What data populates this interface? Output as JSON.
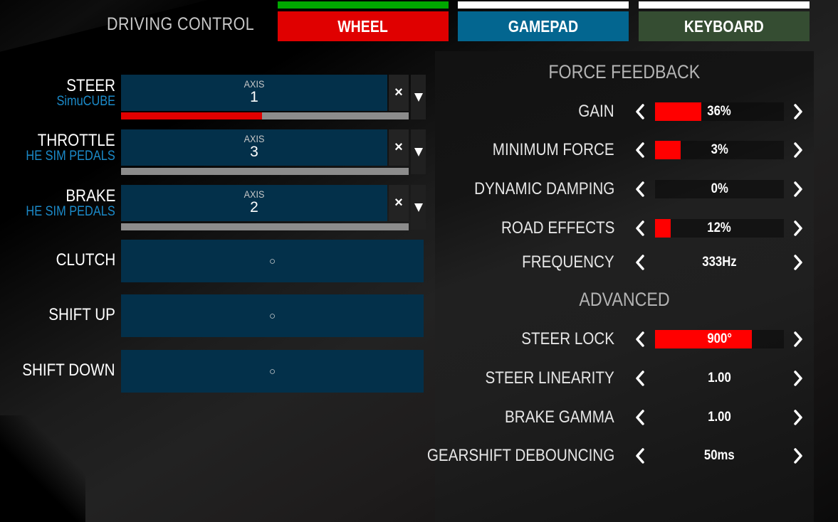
{
  "header": {
    "title": "DRIVING CONTROL",
    "tabs": [
      {
        "label": "WHEEL",
        "color": "#e00000",
        "indicator": "#00a800",
        "active": true
      },
      {
        "label": "GAMEPAD",
        "color": "#036690",
        "indicator": "#ffffff",
        "active": false
      },
      {
        "label": "KEYBOARD",
        "color": "#354d32",
        "indicator": "#ffffff",
        "active": false
      }
    ]
  },
  "axes": [
    {
      "name": "STEER",
      "device": "SimuCUBE",
      "axis_label": "AXIS",
      "axis_number": "1",
      "level": 0.49,
      "clear_icon": "×",
      "dropdown_icon": "▼"
    },
    {
      "name": "THROTTLE",
      "device": "HE SIM PEDALS",
      "axis_label": "AXIS",
      "axis_number": "3",
      "level": 0.0,
      "clear_icon": "×",
      "dropdown_icon": "▼"
    },
    {
      "name": "BRAKE",
      "device": "HE SIM PEDALS",
      "axis_label": "AXIS",
      "axis_number": "2",
      "level": 0.0,
      "clear_icon": "×",
      "dropdown_icon": "▼"
    }
  ],
  "buttons": [
    {
      "name": "CLUTCH",
      "binding": "○"
    },
    {
      "name": "SHIFT UP",
      "binding": "○"
    },
    {
      "name": "SHIFT DOWN",
      "binding": "○"
    }
  ],
  "force_feedback": {
    "title": "FORCE FEEDBACK",
    "settings": [
      {
        "label": "GAIN",
        "value": "36%",
        "level": 0.36,
        "bar": true
      },
      {
        "label": "MINIMUM FORCE",
        "value": "3%",
        "level": 0.2,
        "bar": true
      },
      {
        "label": "DYNAMIC DAMPING",
        "value": "0%",
        "level": 0.0,
        "bar": true
      },
      {
        "label": "ROAD EFFECTS",
        "value": "12%",
        "level": 0.12,
        "bar": true
      },
      {
        "label": "FREQUENCY",
        "value": "333Hz",
        "level": null,
        "bar": false
      }
    ]
  },
  "advanced": {
    "title": "ADVANCED",
    "settings": [
      {
        "label": "STEER LOCK",
        "value": "900°",
        "level": 0.75,
        "bar": true
      },
      {
        "label": "STEER LINEARITY",
        "value": "1.00",
        "level": null,
        "bar": false
      },
      {
        "label": "BRAKE GAMMA",
        "value": "1.00",
        "level": null,
        "bar": false
      },
      {
        "label": "GEARSHIFT DEBOUNCING",
        "value": "50ms",
        "level": null,
        "bar": false
      }
    ]
  },
  "colors": {
    "accent_red": "#ff0000",
    "binding_blue": "#03304a",
    "device_blue": "#1b8ac9"
  }
}
